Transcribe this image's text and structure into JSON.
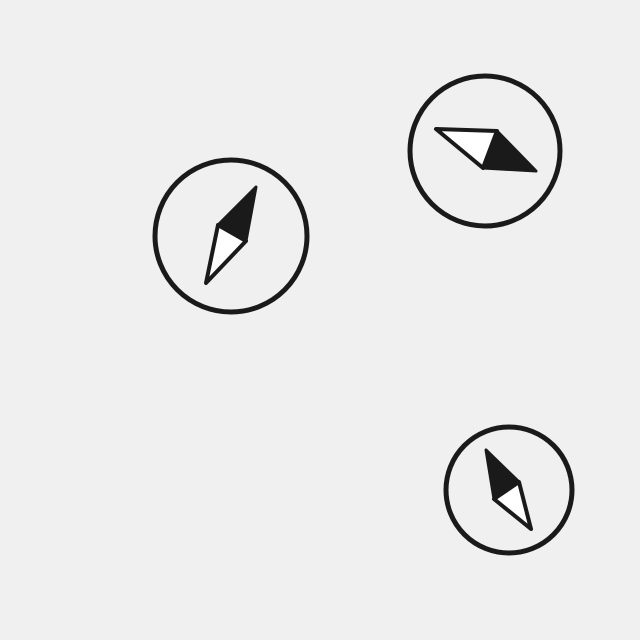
{
  "icons": [
    {
      "name": "compass-icon",
      "stroke_color": "#1a1a1a",
      "background": "#f0f0f0"
    },
    {
      "name": "compass-icon",
      "stroke_color": "#1a1a1a",
      "background": "#f0f0f0"
    },
    {
      "name": "compass-icon",
      "stroke_color": "#1a1a1a",
      "background": "#f0f0f0"
    }
  ]
}
